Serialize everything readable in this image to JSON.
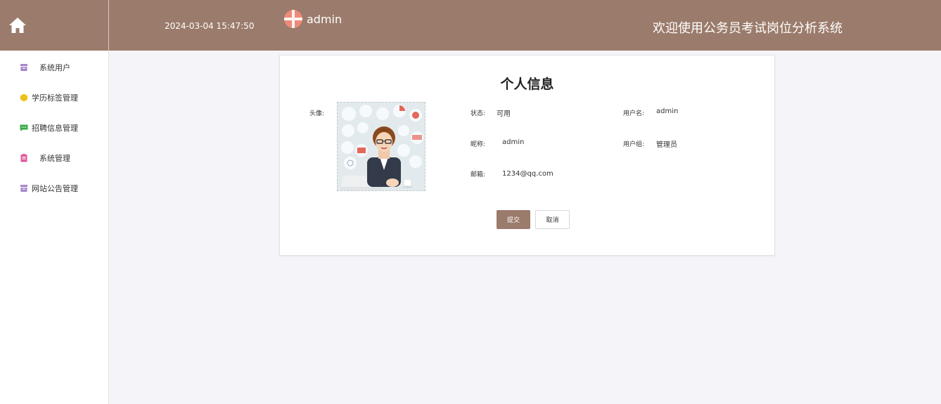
{
  "header": {
    "datetime": "2024-03-04 15:47:50",
    "username": "admin",
    "site_title": "欢迎使用公务员考试岗位分析系统",
    "home_icon": "home-icon",
    "bg_color": "#9b7b6b"
  },
  "sidebar": {
    "items": [
      {
        "label": "系统用户",
        "icon": "archive-icon",
        "color": "#a685c9"
      },
      {
        "label": "学历标签管理",
        "icon": "hexagon-icon",
        "color": "#f0c01a"
      },
      {
        "label": "招聘信息管理",
        "icon": "message-icon",
        "color": "#3aa84a"
      },
      {
        "label": "系统管理",
        "icon": "clipboard-icon",
        "color": "#e05c9a"
      },
      {
        "label": "网站公告管理",
        "icon": "archive-icon",
        "color": "#a685c9"
      }
    ]
  },
  "profile": {
    "title": "个人信息",
    "avatar_label": "头像:",
    "status_label": "状态:",
    "status_value": "可用",
    "username_label": "用户名:",
    "username_value": "admin",
    "nickname_label": "昵称:",
    "nickname_value": "admin",
    "group_label": "用户组:",
    "group_value": "管理员",
    "email_label": "邮箱:",
    "email_value": "1234@qq.com"
  },
  "buttons": {
    "submit": "提交",
    "cancel": "取消"
  }
}
